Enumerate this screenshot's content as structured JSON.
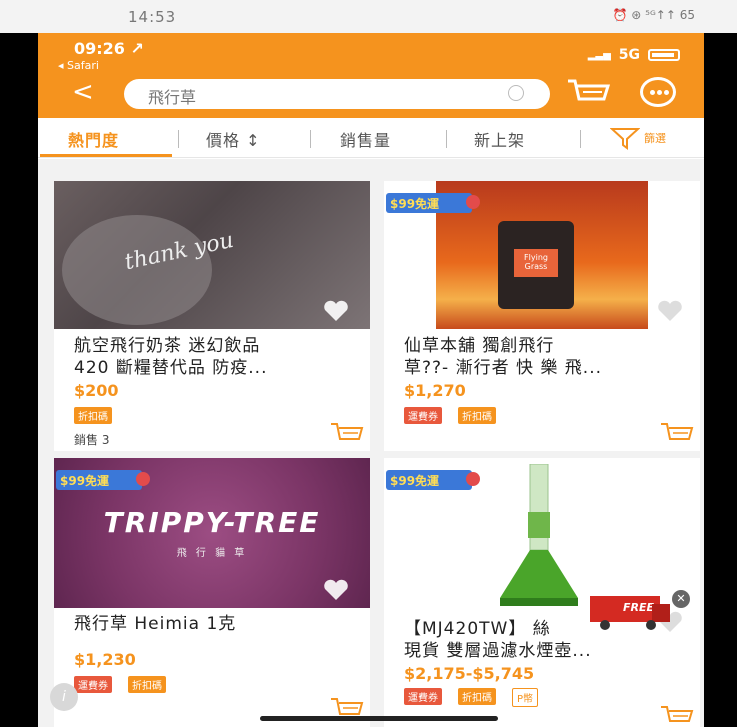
{
  "outer_status": {
    "time": "14:53",
    "right": "⏰ ⊛ ⁵ᴳ↑↑ 65"
  },
  "inner_status": {
    "time": "09:26 ↗",
    "back_app": "◂ Safari",
    "network": "5G"
  },
  "search": {
    "value": "飛行草"
  },
  "tabs": {
    "popular": "熱門度",
    "price": "價格 ↕",
    "sales": "銷售量",
    "new": "新上架",
    "filter": "篩選"
  },
  "products": [
    {
      "title1": "航空飛行奶茶 迷幻飲品",
      "title2": "420 斷糧替代品 防疫...",
      "price": "$200",
      "tag1": "折扣碼",
      "sold": "銷售 3",
      "img_text": "thank you"
    },
    {
      "title1": "仙草本舖 獨創飛行",
      "title2": "草??- 漸行者 快 樂 飛...",
      "price": "$1,270",
      "tag1": "運費券",
      "tag2": "折扣碼",
      "badge": "$99免運",
      "img_text": "Flying Grass"
    },
    {
      "title1": "飛行草 Heimia 1克",
      "price": "$1,230",
      "tag1": "運費券",
      "tag2": "折扣碼",
      "badge": "$99免運",
      "img_big": "TRIPPY-TREE",
      "img_small": "飛 行 貓 草"
    },
    {
      "title1": "【MJ420TW】 絲",
      "title2": "現貨 雙層過濾水煙壺...",
      "price": "$2,175-$5,745",
      "tag1": "運費券",
      "tag2": "折扣碼",
      "tag3": "P幣",
      "badge": "$99免運",
      "free_truck": "FREE"
    }
  ],
  "colors": {
    "accent": "#f5931e",
    "badge_blue": "#3b78d8"
  }
}
